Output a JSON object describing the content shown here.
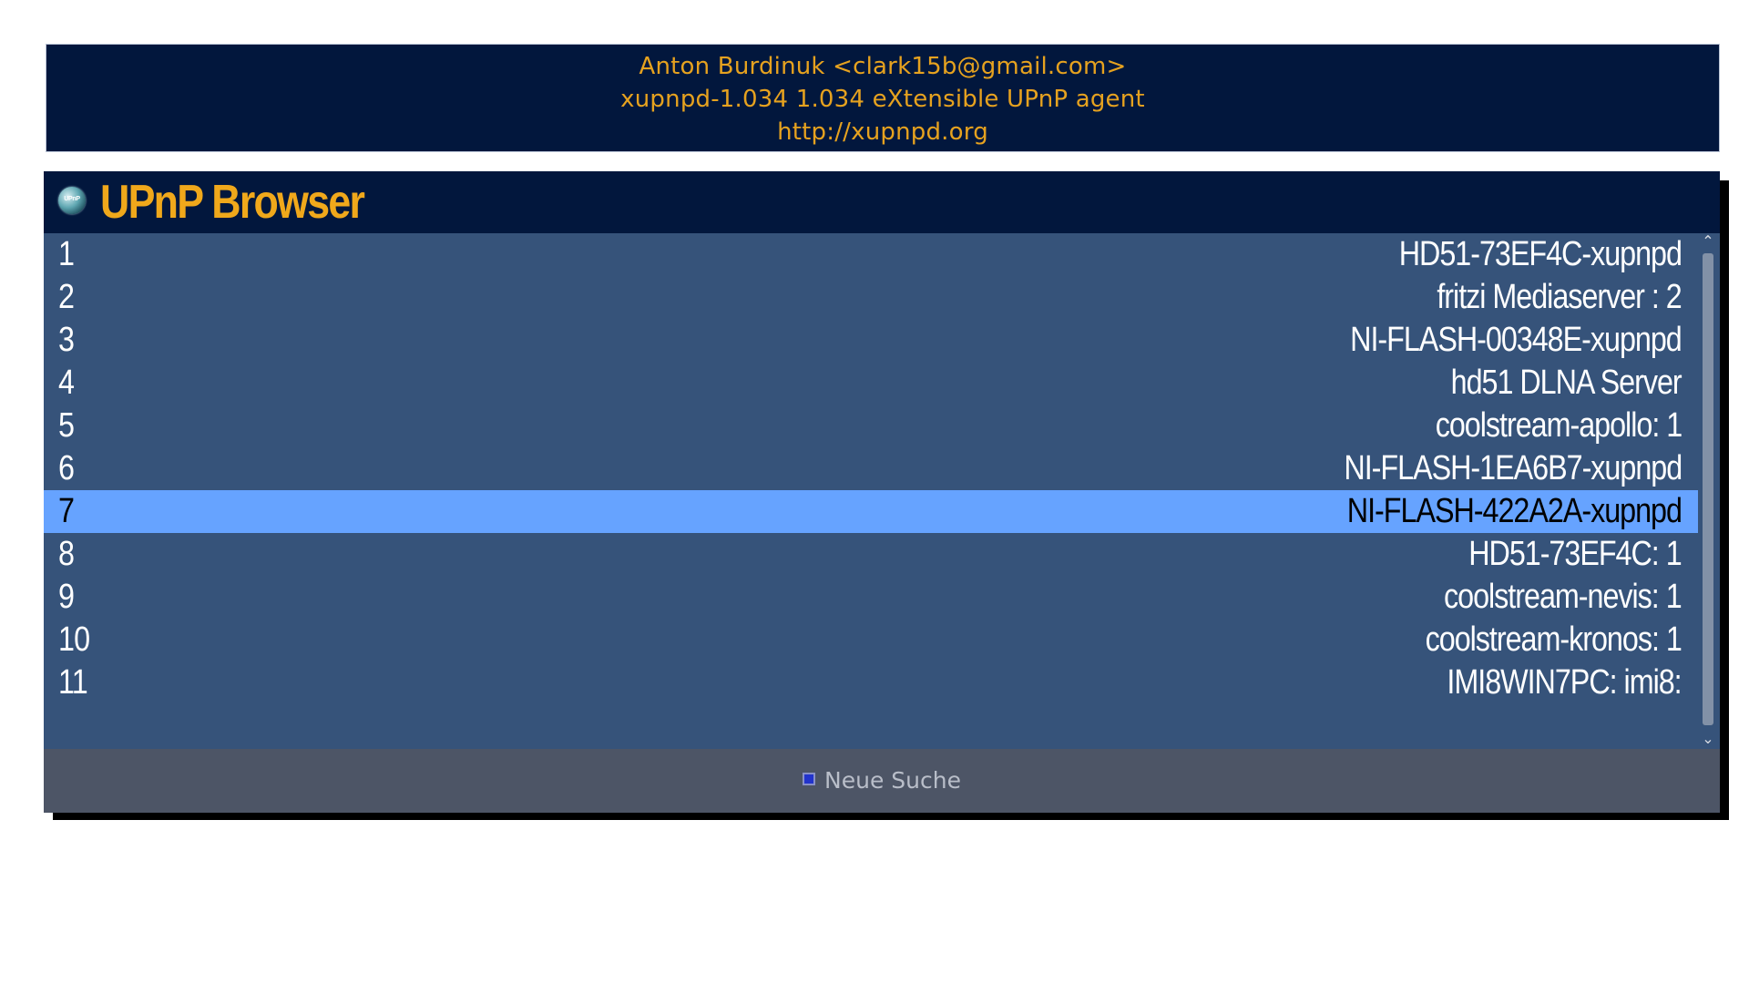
{
  "info": {
    "line1": "Anton Burdinuk <clark15b@gmail.com>",
    "line2": "xupnpd-1.034 1.034 eXtensible UPnP agent",
    "line3": "http://xupnpd.org"
  },
  "window": {
    "icon_label": "UPnP",
    "title": "UPnP Browser"
  },
  "devices": [
    {
      "num": "1",
      "name": "HD51-73EF4C-xupnpd",
      "selected": false
    },
    {
      "num": "2",
      "name": "fritzi Mediaserver : 2",
      "selected": false
    },
    {
      "num": "3",
      "name": "NI-FLASH-00348E-xupnpd",
      "selected": false
    },
    {
      "num": "4",
      "name": "hd51 DLNA Server",
      "selected": false
    },
    {
      "num": "5",
      "name": "coolstream-apollo: 1",
      "selected": false
    },
    {
      "num": "6",
      "name": "NI-FLASH-1EA6B7-xupnpd",
      "selected": false
    },
    {
      "num": "7",
      "name": "NI-FLASH-422A2A-xupnpd",
      "selected": true
    },
    {
      "num": "8",
      "name": "HD51-73EF4C: 1",
      "selected": false
    },
    {
      "num": "9",
      "name": "coolstream-nevis: 1",
      "selected": false
    },
    {
      "num": "10",
      "name": "coolstream-kronos: 1",
      "selected": false
    },
    {
      "num": "11",
      "name": "IMI8WIN7PC: imi8:",
      "selected": false
    }
  ],
  "footer": {
    "button_label": "Neue Suche",
    "button_color": "blue"
  },
  "colors": {
    "accent": "#f0a81b",
    "header_bg": "#02173d",
    "list_bg": "#36537a",
    "selected_bg": "#66a3ff"
  }
}
